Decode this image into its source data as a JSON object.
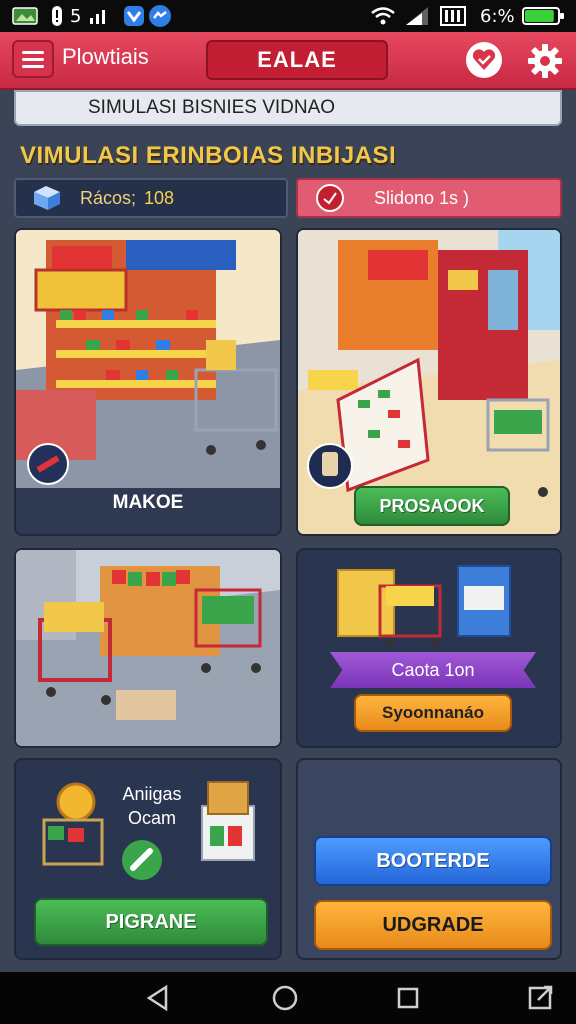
{
  "status_bar": {
    "left_text": "5",
    "clock": "6:%",
    "battery_level_pct": 90
  },
  "topbar": {
    "app_title": "Plowtiais",
    "title_pill": "EALAE"
  },
  "header": {
    "subtitle": "SIMULASI BISNIES VIDNAO",
    "heading": "VIMULASI ERINBOIAS INBIJASI"
  },
  "stats": {
    "left_label": "Rácos;",
    "left_value": "108",
    "right_label": "Slidono 1s )"
  },
  "cards": {
    "store_one": {
      "label": "MAKOE"
    },
    "store_two": {
      "button": "PROSAOOK"
    },
    "products": {
      "ribbon": "Caota 1on",
      "button": "Syoonnanáo"
    },
    "bonus": {
      "line1": "Aniigas",
      "line2": "Ocam",
      "button": "PIGRANE"
    },
    "actions": {
      "blue_button": "BOOTERDE",
      "orange_button": "UDGRADE"
    }
  },
  "colors": {
    "topbar": "#d8344c",
    "background": "#3b4357",
    "heading": "#f2c84b",
    "green_button": "#3aa54a",
    "blue_button": "#2f7ee8",
    "orange_button": "#f29a2a",
    "purple_ribbon": "#8b3fc4"
  },
  "icons": {
    "menu": "hamburger-icon",
    "heart": "heart-check-icon",
    "settings": "gear-icon",
    "nav_back": "triangle-back-icon",
    "nav_home": "circle-home-icon",
    "nav_recent": "square-recent-icon"
  }
}
